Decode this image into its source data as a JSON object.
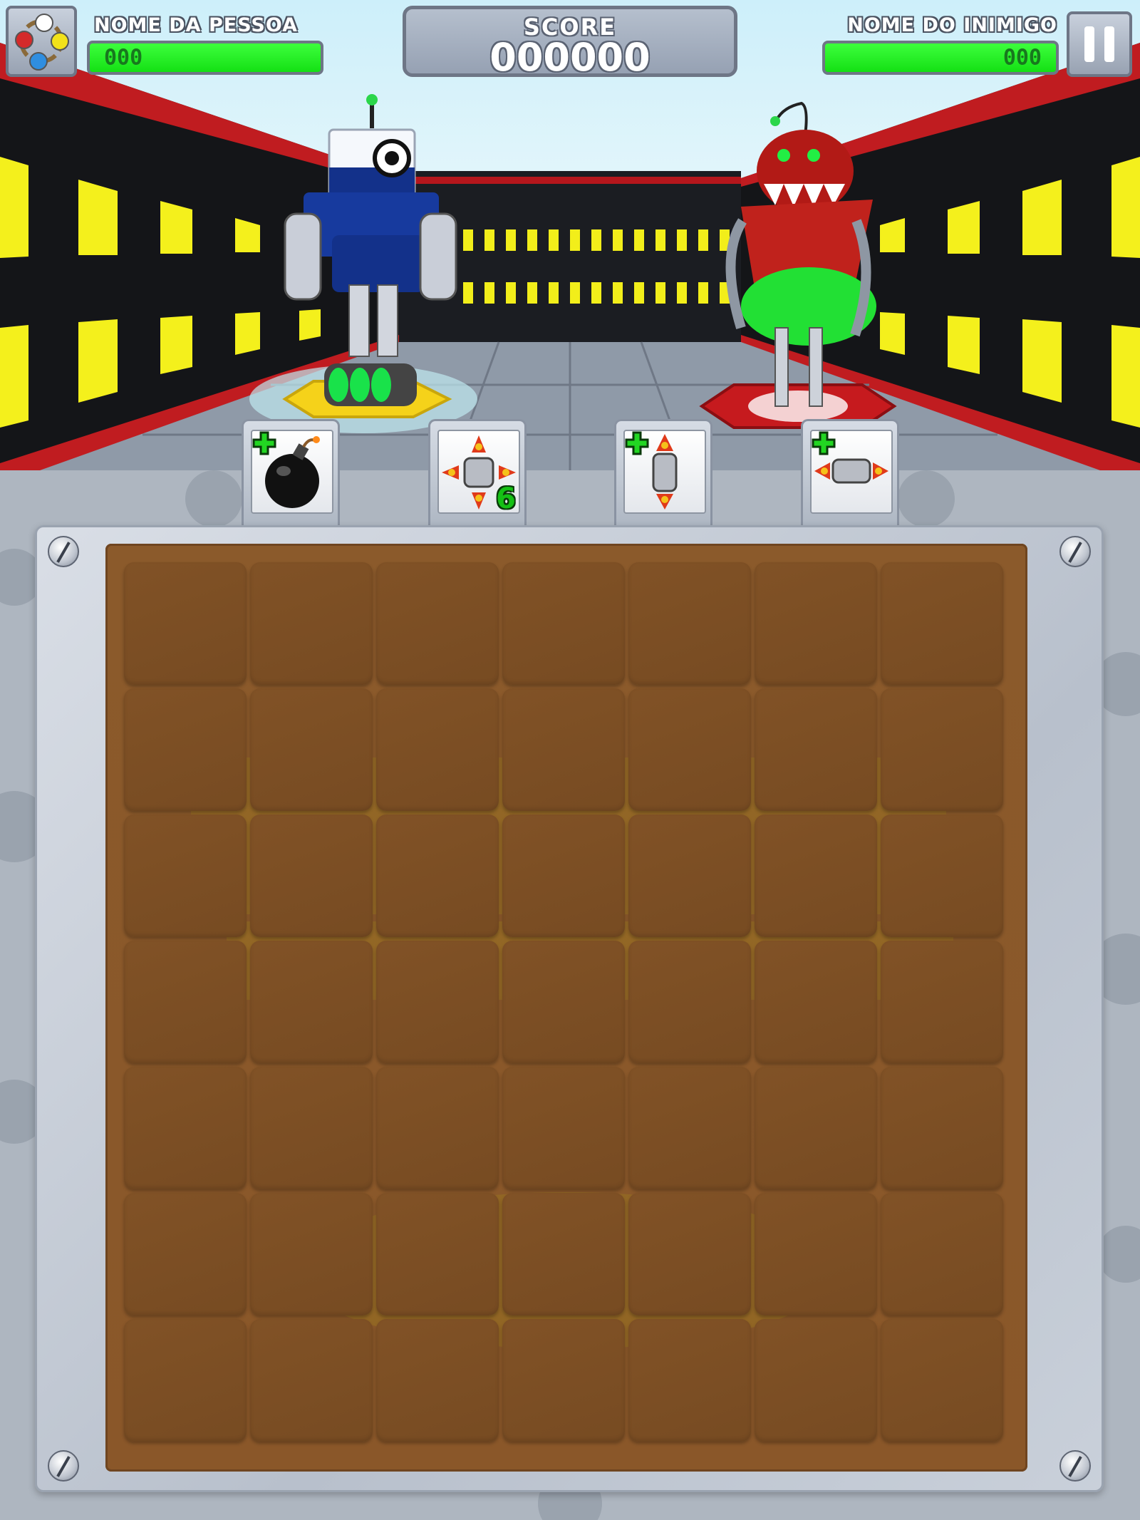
{
  "hud": {
    "player_name": "NOME DA PESSOA",
    "player_hp": "000",
    "score_label": "SCORE",
    "score_value": "000000",
    "enemy_name": "NOME DO INIMIGO",
    "enemy_hp": "000"
  },
  "powerups": [
    {
      "name": "bomb",
      "badge": "plus"
    },
    {
      "name": "cross-rocket",
      "count": "6"
    },
    {
      "name": "vertical-rocket",
      "badge": "plus"
    },
    {
      "name": "horizontal-rocket",
      "badge": "plus"
    }
  ],
  "board": {
    "rows": 7,
    "cols": 7
  },
  "colors": {
    "hp_fill": "#22ee22",
    "board": "#8b5a2b",
    "player_robot": "#13318a",
    "enemy_robot": "#c0221c"
  }
}
